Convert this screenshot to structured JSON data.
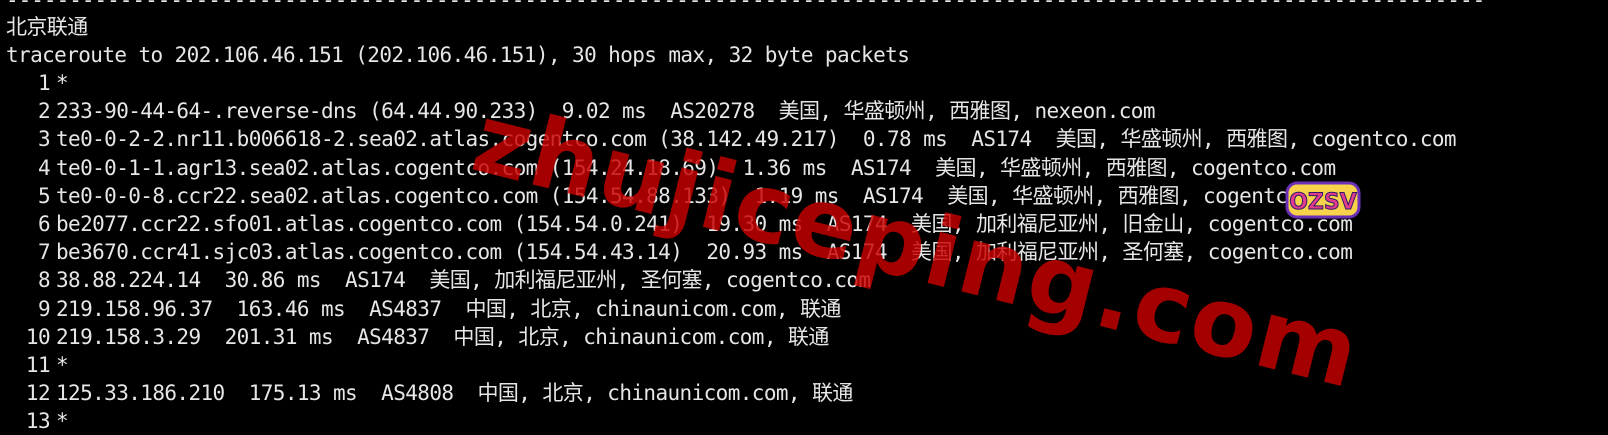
{
  "terminal": {
    "separator": "---------------------------------------------------------------------------------------------------------------------",
    "title": "北京联通",
    "command": "traceroute to 202.106.46.151 (202.106.46.151), 30 hops max, 32 byte packets",
    "hops": [
      {
        "num": "1",
        "text": "*"
      },
      {
        "num": "2",
        "text": "233-90-44-64-.reverse-dns (64.44.90.233)  9.02 ms  AS20278  美国, 华盛顿州, 西雅图, nexeon.com"
      },
      {
        "num": "3",
        "text": "te0-0-2-2.nr11.b006618-2.sea02.atlas.cogentco.com (38.142.49.217)  0.78 ms  AS174  美国, 华盛顿州, 西雅图, cogentco.com"
      },
      {
        "num": "4",
        "text": "te0-0-1-1.agr13.sea02.atlas.cogentco.com (154.24.18.69)  1.36 ms  AS174  美国, 华盛顿州, 西雅图, cogentco.com"
      },
      {
        "num": "5",
        "text": "te0-0-0-8.ccr22.sea02.atlas.cogentco.com (154.54.88.133)  1.19 ms  AS174  美国, 华盛顿州, 西雅图, cogentco.com"
      },
      {
        "num": "6",
        "text": "be2077.ccr22.sfo01.atlas.cogentco.com (154.54.0.241)  19.30 ms  AS174  美国, 加利福尼亚州, 旧金山, cogentco.com"
      },
      {
        "num": "7",
        "text": "be3670.ccr41.sjc03.atlas.cogentco.com (154.54.43.14)  20.93 ms  AS174  美国, 加利福尼亚州, 圣何塞, cogentco.com"
      },
      {
        "num": "8",
        "text": "38.88.224.14  30.86 ms  AS174  美国, 加利福尼亚州, 圣何塞, cogentco.com"
      },
      {
        "num": "9",
        "text": "219.158.96.37  163.46 ms  AS4837  中国, 北京, chinaunicom.com, 联通"
      },
      {
        "num": "10",
        "text": "219.158.3.29  201.31 ms  AS4837  中国, 北京, chinaunicom.com, 联通"
      },
      {
        "num": "11",
        "text": "*"
      },
      {
        "num": "12",
        "text": "125.33.186.210  175.13 ms  AS4808  中国, 北京, chinaunicom.com, 联通"
      },
      {
        "num": "13",
        "text": "*"
      }
    ]
  },
  "watermark": {
    "text": "zhujiceping.com",
    "badge": "OZSV",
    "color": "#c80000"
  },
  "colors": {
    "background": "#000000",
    "foreground": "#e6e6e6"
  }
}
